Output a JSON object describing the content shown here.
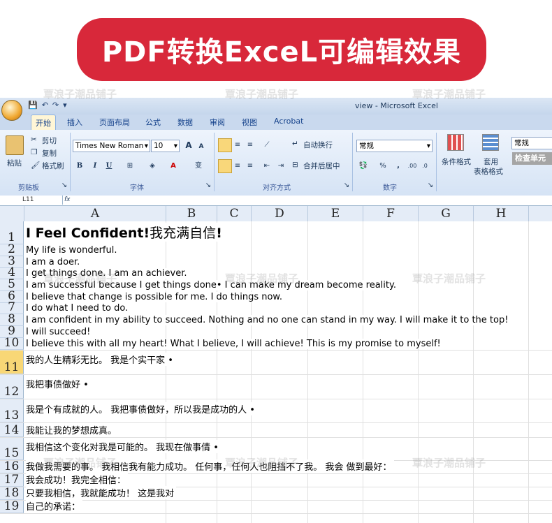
{
  "banner": {
    "text": "PDF转换ExceL可编辑效果"
  },
  "watermark": "覃浪子潮品铺子",
  "window": {
    "title": "view - Microsoft Excel",
    "qat": [
      "💾",
      "↶",
      "↷",
      "▾"
    ]
  },
  "tabs": [
    "开始",
    "插入",
    "页面布局",
    "公式",
    "数据",
    "审阅",
    "视图",
    "Acrobat"
  ],
  "ribbon": {
    "clipboard": {
      "paste": "粘贴",
      "cut": "剪切",
      "copy": "复制",
      "format_painter": "格式刷",
      "label": "剪贴板"
    },
    "font": {
      "name": "Times New Roman",
      "size": "10",
      "label": "字体",
      "bold": "B",
      "italic": "I",
      "underline": "U",
      "grow": "A",
      "shrink": "A",
      "color": "A",
      "phonetic": "变"
    },
    "alignment": {
      "wrap": "自动换行",
      "merge": "合并后居中",
      "label": "对齐方式"
    },
    "number": {
      "format": "常规",
      "percent": "%",
      "comma": ",",
      "label": "数字"
    },
    "styles": {
      "conditional": "条件格式",
      "table_format_1": "套用",
      "table_format_2": "表格格式",
      "cell_style_box": "常规",
      "check_cell": "检查单元"
    }
  },
  "formula_bar": {
    "name_box": "L11",
    "fx": "fx"
  },
  "columns": [
    "A",
    "B",
    "C",
    "D",
    "E",
    "F",
    "G",
    "H"
  ],
  "rows": [
    {
      "num": "1",
      "text": "",
      "title_en": "I Feel Confident!",
      "title_zh": "我充满自信",
      "title_end": "!"
    },
    {
      "num": "2",
      "text": "My life is wonderful."
    },
    {
      "num": "3",
      "text": "I am a doer."
    },
    {
      "num": "4",
      "text": "I get things done. I am an achiever."
    },
    {
      "num": "5",
      "text": "I am successful because I get things done• I can make my dream become reality."
    },
    {
      "num": "6",
      "text": "I believe that change is possible for me. I do things now."
    },
    {
      "num": "7",
      "text": "I do what I need to do."
    },
    {
      "num": "8",
      "text": "I am confident in my ability to succeed. Nothing and no one can stand in my way. I will make it to the top!"
    },
    {
      "num": "9",
      "text": "I will succeed!"
    },
    {
      "num": "10",
      "text": "I believe this with all my heart! What I believe, I will achieve! This is my promise to myself!"
    },
    {
      "num": "11",
      "text": "我的人生精彩无比。 我是个实干家 •"
    },
    {
      "num": "12",
      "text": "我把事债做好 •"
    },
    {
      "num": "13",
      "text": "我是个有成就的人。 我把事债做好，所以我是成功的人 •"
    },
    {
      "num": "14",
      "text": "我能让我的梦想成真。"
    },
    {
      "num": "15",
      "text": "我相信这个变化对我是可能的。 我现在做事倩 •"
    },
    {
      "num": "16",
      "text": "我做我需要的事。 我相信我有能力成功。 任何事，任何人也阻挡不了我。 我会 做到最好："
    },
    {
      "num": "17",
      "text": "我会成功！我完全相信："
    },
    {
      "num": "18",
      "text": "只要我相信，我就能成功！ 这是我对"
    },
    {
      "num": "19",
      "text": "自己的承诺："
    }
  ]
}
